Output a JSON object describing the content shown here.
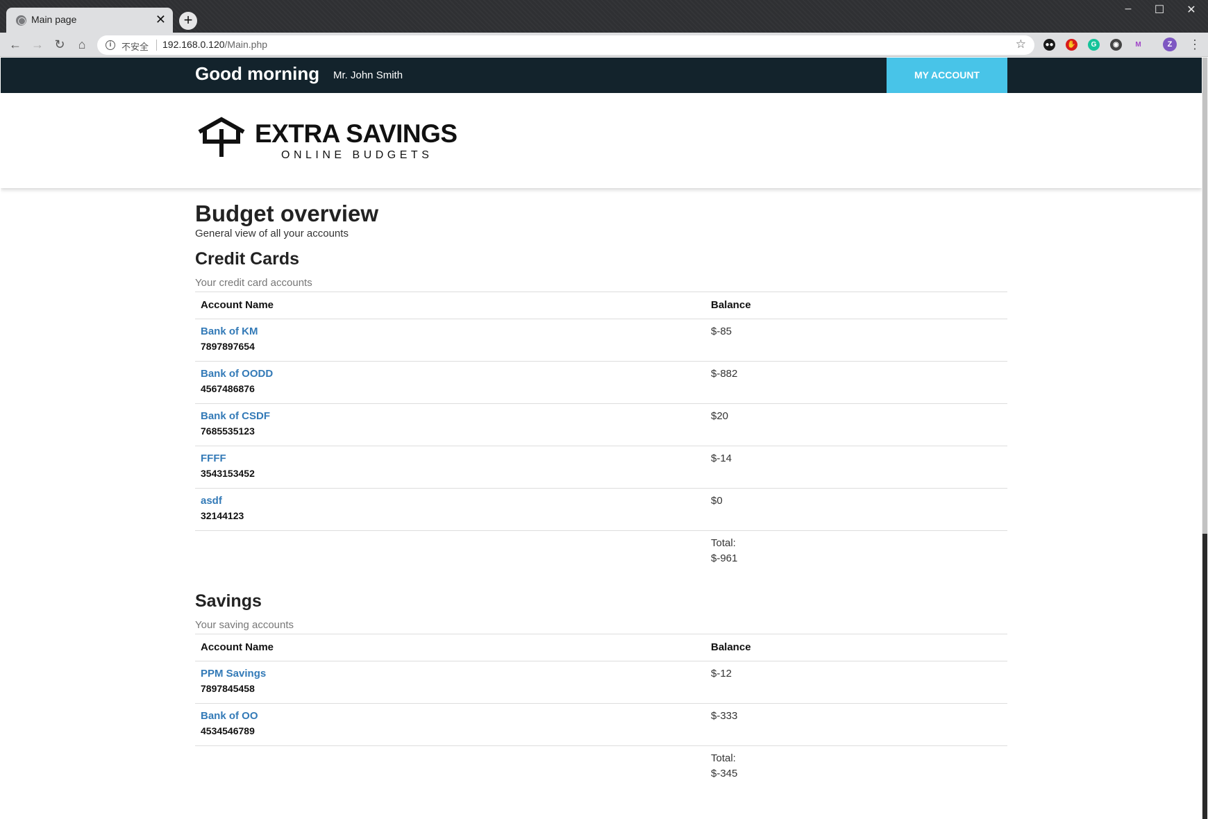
{
  "browser": {
    "tab_title": "Main page",
    "new_tab_symbol": "+",
    "address_security": "不安全",
    "address_host": "192.168.0.120",
    "address_path": "/Main.php",
    "window_controls": {
      "minimize": "–",
      "maximize": "☐",
      "close": "✕"
    },
    "extensions": [
      {
        "name": "tampermonkey-icon",
        "color": "#1a1a1a"
      },
      {
        "name": "adblock-icon",
        "color": "#d81b1b"
      },
      {
        "name": "grammarly-icon",
        "color": "#15c39a"
      },
      {
        "name": "incognito-icon",
        "color": "#444444"
      },
      {
        "name": "extension-icon",
        "color": "#a044c8"
      }
    ],
    "profile_initial": "Z",
    "profile_color": "#7e57c2"
  },
  "header": {
    "greeting": "Good morning",
    "user_name": "Mr. John Smith",
    "my_account_label": "MY ACCOUNT"
  },
  "logo": {
    "title": "EXTRA SAVINGS",
    "subtitle": "ONLINE BUDGETS"
  },
  "main": {
    "title": "Budget overview",
    "subtitle": "General view of all your accounts"
  },
  "credit_cards": {
    "title": "Credit Cards",
    "subtitle": "Your credit card accounts",
    "columns": [
      "Account Name",
      "Balance"
    ],
    "rows": [
      {
        "name": "Bank of KM",
        "number": "7897897654",
        "balance": "$-85"
      },
      {
        "name": "Bank of OODD",
        "number": "4567486876",
        "balance": "$-882"
      },
      {
        "name": "Bank of CSDF",
        "number": "7685535123",
        "balance": "$20"
      },
      {
        "name": "FFFF",
        "number": "3543153452",
        "balance": "$-14"
      },
      {
        "name": "asdf",
        "number": "32144123",
        "balance": "$0"
      }
    ],
    "total_label": "Total:",
    "total_value": "$-961"
  },
  "savings": {
    "title": "Savings",
    "subtitle": "Your saving accounts",
    "columns": [
      "Account Name",
      "Balance"
    ],
    "rows": [
      {
        "name": "PPM Savings",
        "number": "7897845458",
        "balance": "$-12"
      },
      {
        "name": "Bank of OO",
        "number": "4534546789",
        "balance": "$-333"
      }
    ],
    "total_label": "Total:",
    "total_value": "$-345"
  },
  "colors": {
    "header_bg": "#13232c",
    "accent": "#48c4e8",
    "link": "#337ab7"
  }
}
